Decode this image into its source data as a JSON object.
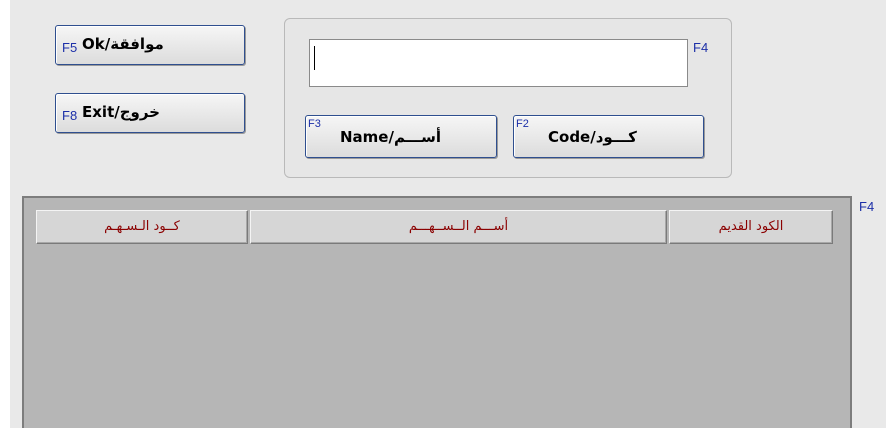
{
  "buttons": {
    "ok": {
      "label": "Ok/موافقة",
      "key": "F5"
    },
    "exit": {
      "label": "Exit/خروج",
      "key": "F8"
    },
    "code": {
      "label": "Code/كـــود",
      "key": "F2"
    },
    "name": {
      "label": "Name/أســـم",
      "key": "F3"
    }
  },
  "search": {
    "value": "",
    "key": "F4"
  },
  "grid": {
    "key": "F4",
    "columns": [
      "كــود الـسـهـم",
      "أســـم الــســهـــم",
      "الكود القديم"
    ]
  },
  "colors": {
    "header_text": "#8b0000",
    "key_text": "#1c2fa8",
    "grid_bg": "#b6b6b6"
  }
}
